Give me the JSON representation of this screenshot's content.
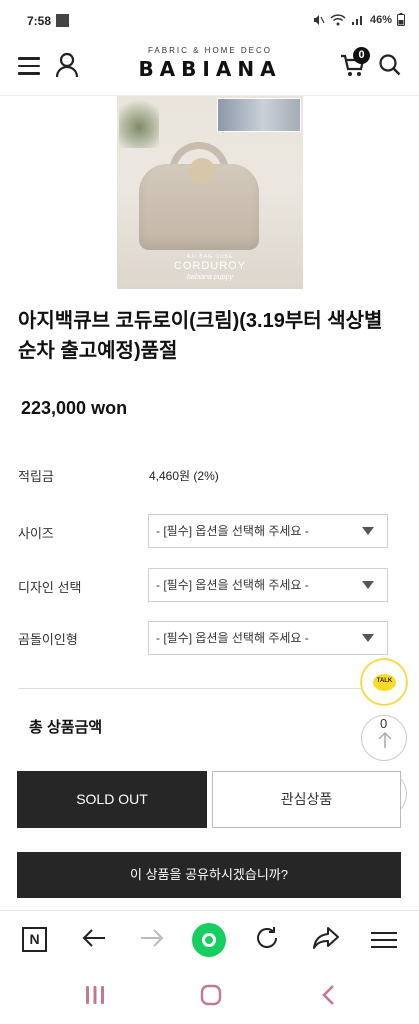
{
  "status_bar": {
    "time": "7:58",
    "battery": "46%"
  },
  "header": {
    "logo_sub": "FABRIC & HOME DECO",
    "logo_main": "BABIANA",
    "cart_count": "0"
  },
  "product_image": {
    "caption_small": "AJI BAG CUBE",
    "caption": "CORDUROY",
    "caption_script": "babiana puppy"
  },
  "product": {
    "title": "아지백큐브 코듀로이(크림)(3.19부터 색상별 순차 출고예정)품절",
    "price": "223,000 won"
  },
  "info_rows": [
    {
      "label": "적립금",
      "value": "4,460원 (2%)"
    },
    {
      "label": "사이즈",
      "value": "- [필수] 옵션을 선택해 주세요 -"
    },
    {
      "label": "디자인 선택",
      "value": "- [필수] 옵션을 선택해 주세요 -"
    },
    {
      "label": "곰돌이인형",
      "value": "- [필수] 옵션을 선택해 주세요 -"
    }
  ],
  "total_label": "총 상품금액",
  "floating": {
    "talk_label": "TALK",
    "count": "0"
  },
  "buttons": {
    "sold_out": "SOLD OUT",
    "wishlist": "관심상품",
    "share": "이 상품을 공유하시겠습니까?"
  },
  "browser_toolbar": {
    "naver_label": "N"
  },
  "colors": {
    "dark_button": "#262626",
    "talk_yellow": "#f9dc27",
    "naver_green": "#19ce60"
  }
}
